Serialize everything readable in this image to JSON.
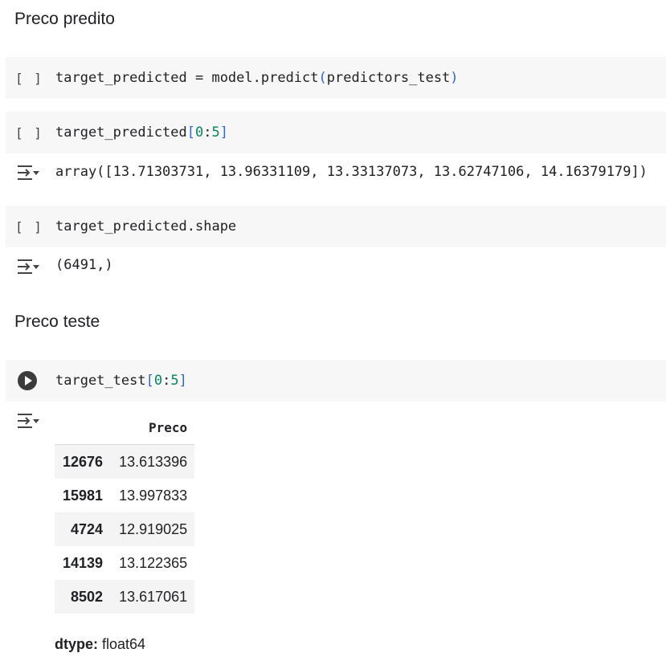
{
  "sections": {
    "predicted_title": "Preco predito",
    "test_title": "Preco teste"
  },
  "cells": {
    "c1": {
      "run_label": "[ ]",
      "code_prefix": "target_predicted = model.predict",
      "code_open": "(",
      "code_arg": "predictors_test",
      "code_close": ")"
    },
    "c2": {
      "run_label": "[ ]",
      "code_prefix": "target_predicted",
      "code_open": "[",
      "code_start": "0",
      "code_colon": ":",
      "code_end": "5",
      "code_close": "]",
      "output": "array([13.71303731, 13.96331109, 13.33137073, 13.62747106, 14.16379179])"
    },
    "c3": {
      "run_label": "[ ]",
      "code": "target_predicted.shape",
      "output": "(6491,)"
    },
    "c4": {
      "code_prefix": "target_test",
      "code_open": "[",
      "code_start": "0",
      "code_colon": ":",
      "code_end": "5",
      "code_close": "]"
    }
  },
  "table": {
    "column": "Preco",
    "rows": [
      {
        "index": "12676",
        "value": "13.613396"
      },
      {
        "index": "15981",
        "value": "13.997833"
      },
      {
        "index": "4724",
        "value": "12.919025"
      },
      {
        "index": "14139",
        "value": "13.122365"
      },
      {
        "index": "8502",
        "value": "13.617061"
      }
    ],
    "dtype_label": "dtype:",
    "dtype_value": "float64"
  },
  "icons": {
    "run_cell": "play-icon",
    "output_toggle": "output-toggle-icon"
  }
}
